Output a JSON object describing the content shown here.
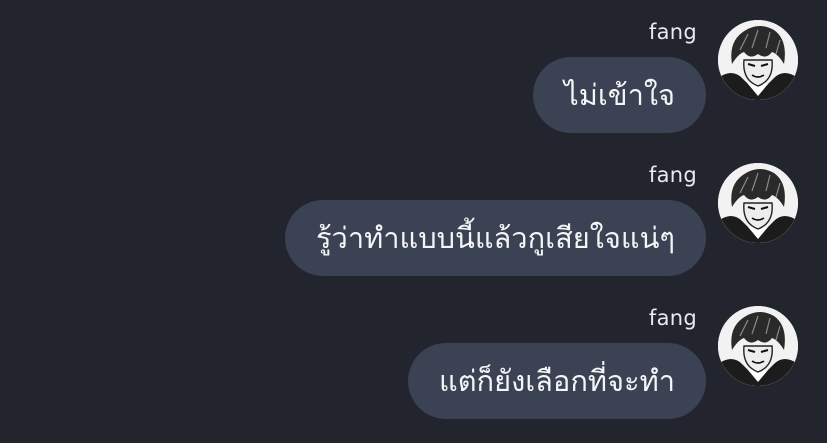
{
  "messages": [
    {
      "sender": "fang",
      "text": "ไม่เข้าใจ",
      "avatar_icon": "user-avatar-icon"
    },
    {
      "sender": "fang",
      "text": "รู้ว่าทำแบบนี้แล้วกูเสียใจแน่ๆ",
      "avatar_icon": "user-avatar-icon"
    },
    {
      "sender": "fang",
      "text": "แต่ก็ยังเลือกที่จะทำ",
      "avatar_icon": "user-avatar-icon"
    }
  ],
  "colors": {
    "background": "#22252e",
    "bubble": "#3a4253",
    "text": "#f4f5f7"
  }
}
